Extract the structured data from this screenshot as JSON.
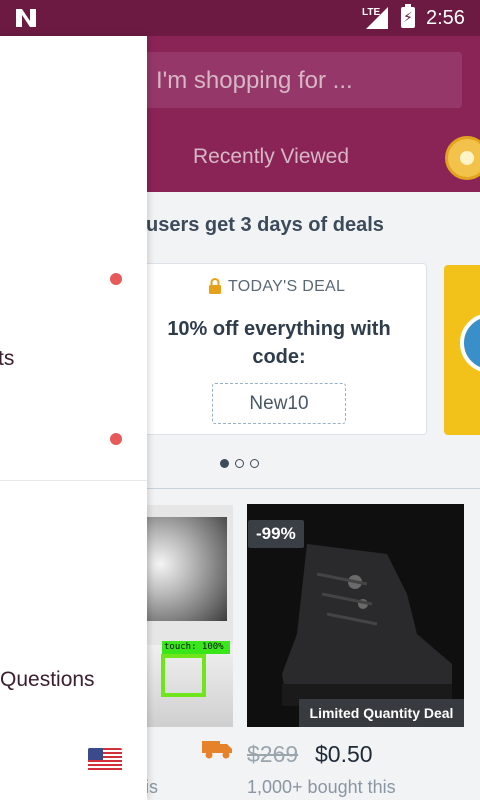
{
  "status_bar": {
    "network": "LTE",
    "time": "2:56",
    "icons": [
      "n-logo-icon",
      "signal-icon",
      "battery-charging-icon"
    ]
  },
  "header": {
    "search_placeholder": "I'm shopping for ...",
    "tab_label": "Recently Viewed",
    "reward_icon": "coin-icon"
  },
  "promo": {
    "banner": "users get 3 days of deals",
    "deal_label": "TODAY'S DEAL",
    "deal_title": "10% off everything with code:",
    "code": "New10",
    "carousel_page": 1,
    "carousel_total": 3
  },
  "products": [
    {
      "sold": ": this",
      "shipping_icon": "truck-icon"
    },
    {
      "discount": "-99%",
      "badge": "Limited Quantity Deal",
      "old_price": "$269",
      "price": "$0.50",
      "sold": "1,000+ bought this"
    }
  ],
  "touch_overlay": {
    "label": "touch: 100%"
  },
  "drawer": {
    "items": [
      {
        "label": "ts"
      },
      {
        "label": "Questions"
      }
    ],
    "region_icon": "us-flag-icon"
  },
  "colors": {
    "status_bar": "#6c1a42",
    "header": "#8a2457",
    "accent_dot": "#e85a5a"
  }
}
